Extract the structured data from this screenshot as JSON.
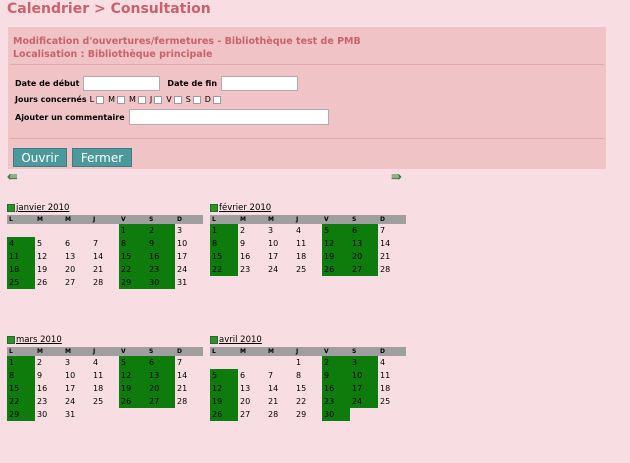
{
  "page": {
    "title": "Calendrier > Consultation"
  },
  "form": {
    "heading_line1": "Modification d'ouvertures/fermetures - Bibliothèque test de PMB",
    "heading_line2": "Localisation : Bibliothèque principale",
    "date_debut_label": "Date de début",
    "date_fin_label": "Date de fin",
    "jours_label": "Jours concernés",
    "days": [
      "L",
      "M",
      "M",
      "J",
      "V",
      "S",
      "D"
    ],
    "commentaire_label": "Ajouter un commentaire",
    "date_debut_value": "",
    "date_fin_value": "",
    "commentaire_value": ""
  },
  "buttons": {
    "ouvrir": "Ouvrir",
    "fermer": "Fermer"
  },
  "nav": {
    "prev_icon": "double-arrow-left",
    "next_icon": "double-arrow-right"
  },
  "colors": {
    "open_day": "#0d7c0d",
    "panel": "#f0c3c7",
    "title": "#c9626b",
    "button": "#4b999b"
  },
  "day_headers": [
    "L",
    "M",
    "M",
    "J",
    "V",
    "S",
    "D"
  ],
  "calendars": [
    {
      "title": "janvier 2010",
      "offset": 4,
      "days": 31,
      "green": [
        1,
        2,
        4,
        8,
        9,
        11,
        15,
        16,
        18,
        22,
        23,
        25,
        29,
        30
      ]
    },
    {
      "title": "février 2010",
      "offset": 0,
      "days": 28,
      "green": [
        1,
        5,
        6,
        8,
        12,
        13,
        15,
        19,
        20,
        22,
        26,
        27
      ]
    },
    {
      "title": "mars 2010",
      "offset": 0,
      "days": 31,
      "green": [
        1,
        5,
        6,
        8,
        12,
        13,
        15,
        19,
        20,
        22,
        26,
        27,
        29
      ]
    },
    {
      "title": "avril 2010",
      "offset": 3,
      "days": 30,
      "green": [
        2,
        3,
        5,
        9,
        10,
        12,
        16,
        17,
        19,
        23,
        24,
        26,
        30
      ]
    }
  ]
}
